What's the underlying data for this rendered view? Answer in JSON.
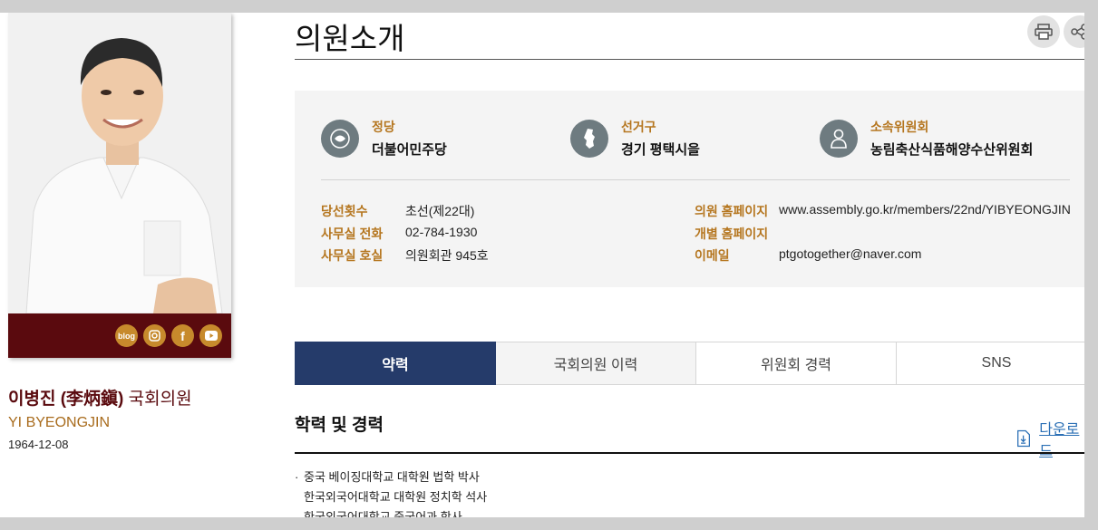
{
  "page": {
    "title": "의원소개"
  },
  "profile": {
    "name_bold": "이병진 (李炳鎭)",
    "name_suffix": " 국회의원",
    "english_name": "YI BYEONGJIN",
    "birth": "1964-12-08",
    "sns": [
      {
        "label": "blog",
        "icon": "blog-icon"
      },
      {
        "label": "",
        "icon": "instagram-icon"
      },
      {
        "label": "f",
        "icon": "facebook-icon"
      },
      {
        "label": "",
        "icon": "youtube-icon"
      }
    ]
  },
  "info": {
    "party_label": "정당",
    "party_value": "더불어민주당",
    "district_label": "선거구",
    "district_value": "경기 평택시을",
    "committee_label": "소속위원회",
    "committee_value": "농림축산식품해양수산위원회"
  },
  "details": {
    "terms_label": "당선횟수",
    "terms_value": "초선(제22대)",
    "phone_label": "사무실 전화",
    "phone_value": "02-784-1930",
    "room_label": "사무실 호실",
    "room_value": "의원회관 945호",
    "homepage_label": "의원 홈페이지",
    "homepage_value": "www.assembly.go.kr/members/22nd/YIBYEONGJIN",
    "personal_homepage_label": "개별 홈페이지",
    "email_label": "이메일",
    "email_value": "ptgotogether@naver.com"
  },
  "tabs": [
    "약력",
    "국회의원 이력",
    "위원회 경력",
    "SNS"
  ],
  "section": {
    "title": "학력 및 경력",
    "download_label": "다운로드",
    "education": [
      "중국 베이징대학교 대학원 법학 박사",
      "한국외국어대학교 대학원 정치학 석사",
      "한국외국어대학교 중국어과 학사"
    ]
  },
  "colors": {
    "brand_dark_red": "#5a0a0e",
    "accent_gold": "#b5761f",
    "tab_active": "#253b6a",
    "link_blue": "#2a6fb5"
  }
}
